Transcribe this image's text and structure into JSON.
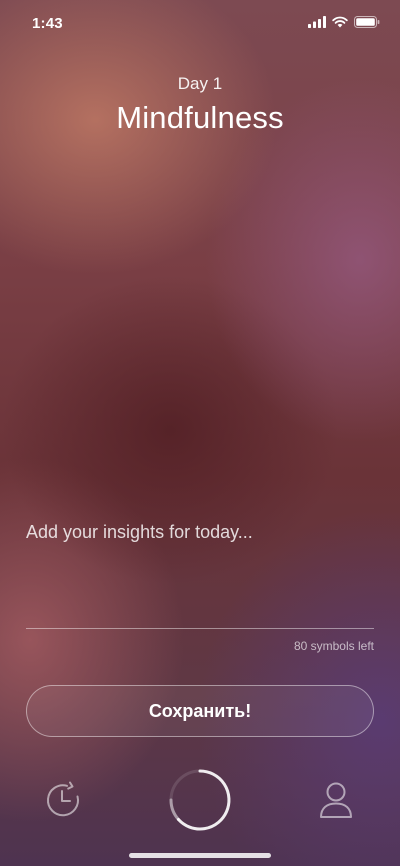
{
  "status_bar": {
    "time": "1:43"
  },
  "header": {
    "day_label": "Day 1",
    "title": "Mindfulness"
  },
  "insight": {
    "placeholder": "Add your insights for today...",
    "value": "",
    "counter_text": "80 symbols left"
  },
  "save_button": {
    "label": "Сохранить!"
  },
  "tab_bar": {
    "items": [
      {
        "name": "history",
        "icon": "history-clock-icon"
      },
      {
        "name": "timer",
        "icon": "progress-ring-icon"
      },
      {
        "name": "profile",
        "icon": "user-icon"
      }
    ]
  },
  "colors": {
    "text": "#ffffff",
    "accent_ring": "#ffffff"
  }
}
